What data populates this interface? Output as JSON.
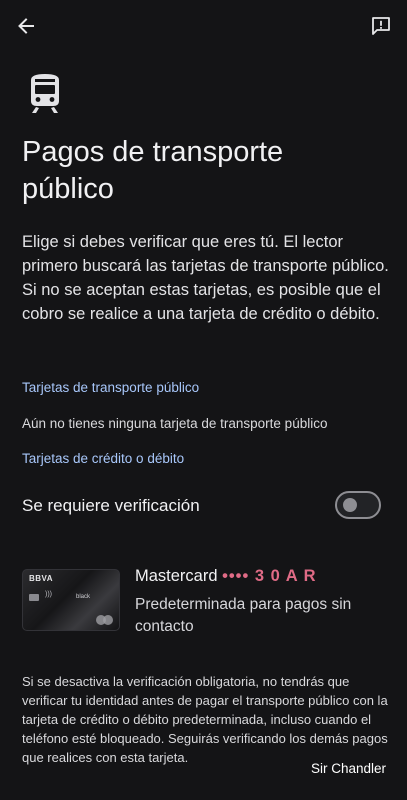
{
  "header": {
    "back_icon": "arrow-back-icon",
    "feedback_icon": "feedback-icon"
  },
  "hero": {
    "icon": "train-icon",
    "title": "Pagos de transporte público",
    "description": "Elige si debes verificar que eres tú. El lector primero buscará las tarjetas de transporte público. Si no se aceptan estas tarjetas, es posible que el cobro se realice a una tarjeta de crédito o débito."
  },
  "transit_section": {
    "header": "Tarjetas de transporte público",
    "empty_text": "Aún no tienes ninguna tarjeta de transporte público"
  },
  "credit_section": {
    "header": "Tarjetas de crédito o débito",
    "verification_label": "Se requiere verificación",
    "verification_enabled": false
  },
  "card": {
    "bank": "BBVA",
    "tier": "black",
    "name": "Mastercard",
    "masked_digits": "•••• 3 0 A R",
    "subtitle": "Predeterminada para pagos sin contacto"
  },
  "footnote": "Si se desactiva la verificación obligatoria, no tendrás que verificar tu identidad antes de pagar el transporte público con la tarjeta de crédito o débito predeterminada, incluso cuando el teléfono esté bloqueado. Seguirás verificando los demás pagos que realices con esta tarjeta.",
  "watermark": "Sir Chandler",
  "colors": {
    "background": "#141416",
    "accent_link": "#a8c7fa",
    "text_primary": "#f1f1f3",
    "toggle_outline": "#8e8e93"
  }
}
